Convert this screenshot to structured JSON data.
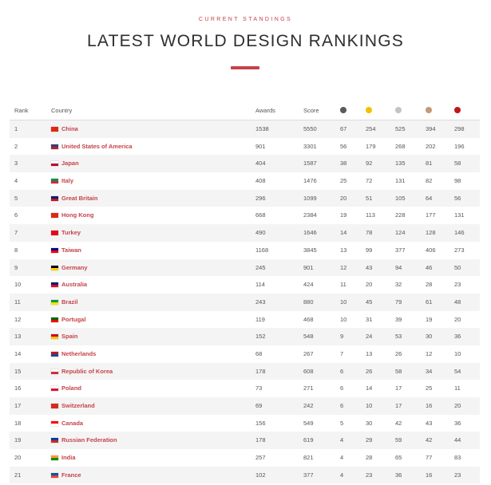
{
  "header": {
    "eyebrow": "CURRENT STANDINGS",
    "title": "LATEST WORLD DESIGN RANKINGS"
  },
  "table": {
    "columns": {
      "rank": "Rank",
      "country": "Country",
      "awards": "Awards",
      "score": "Score"
    },
    "medal_colors": [
      "#5a5a5a",
      "#f2c200",
      "#c4c4c4",
      "#c49a78",
      "#c0171c"
    ],
    "rows": [
      {
        "rank": "1",
        "country": "China",
        "flag": [
          "#de2910",
          "#de2910"
        ],
        "awards": "1538",
        "score": "5550",
        "m": [
          "67",
          "254",
          "525",
          "394",
          "298"
        ]
      },
      {
        "rank": "2",
        "country": "United States of America",
        "flag": [
          "#3c3b6e",
          "#b22234"
        ],
        "awards": "901",
        "score": "3301",
        "m": [
          "56",
          "179",
          "268",
          "202",
          "196"
        ]
      },
      {
        "rank": "3",
        "country": "Japan",
        "flag": [
          "#ffffff",
          "#bc002d"
        ],
        "awards": "404",
        "score": "1587",
        "m": [
          "38",
          "92",
          "135",
          "81",
          "58"
        ]
      },
      {
        "rank": "4",
        "country": "Italy",
        "flag": [
          "#009246",
          "#ce2b37"
        ],
        "awards": "408",
        "score": "1476",
        "m": [
          "25",
          "72",
          "131",
          "82",
          "98"
        ]
      },
      {
        "rank": "5",
        "country": "Great Britain",
        "flag": [
          "#012169",
          "#c8102e"
        ],
        "awards": "296",
        "score": "1099",
        "m": [
          "20",
          "51",
          "105",
          "64",
          "56"
        ]
      },
      {
        "rank": "6",
        "country": "Hong Kong",
        "flag": [
          "#de2910",
          "#de2910"
        ],
        "awards": "668",
        "score": "2384",
        "m": [
          "19",
          "113",
          "228",
          "177",
          "131"
        ]
      },
      {
        "rank": "7",
        "country": "Turkey",
        "flag": [
          "#e30a17",
          "#e30a17"
        ],
        "awards": "490",
        "score": "1646",
        "m": [
          "14",
          "78",
          "124",
          "128",
          "146"
        ]
      },
      {
        "rank": "8",
        "country": "Taiwan",
        "flag": [
          "#000095",
          "#fe0000"
        ],
        "awards": "1168",
        "score": "3845",
        "m": [
          "13",
          "99",
          "377",
          "406",
          "273"
        ]
      },
      {
        "rank": "9",
        "country": "Germany",
        "flag": [
          "#000000",
          "#ffce00"
        ],
        "awards": "245",
        "score": "901",
        "m": [
          "12",
          "43",
          "94",
          "46",
          "50"
        ]
      },
      {
        "rank": "10",
        "country": "Australia",
        "flag": [
          "#012169",
          "#e4002b"
        ],
        "awards": "114",
        "score": "424",
        "m": [
          "11",
          "20",
          "32",
          "28",
          "23"
        ]
      },
      {
        "rank": "11",
        "country": "Brazil",
        "flag": [
          "#009c3b",
          "#ffdf00"
        ],
        "awards": "243",
        "score": "880",
        "m": [
          "10",
          "45",
          "79",
          "61",
          "48"
        ]
      },
      {
        "rank": "12",
        "country": "Portugal",
        "flag": [
          "#006600",
          "#ff0000"
        ],
        "awards": "119",
        "score": "468",
        "m": [
          "10",
          "31",
          "39",
          "19",
          "20"
        ]
      },
      {
        "rank": "13",
        "country": "Spain",
        "flag": [
          "#c60b1e",
          "#ffc400"
        ],
        "awards": "152",
        "score": "548",
        "m": [
          "9",
          "24",
          "53",
          "30",
          "36"
        ]
      },
      {
        "rank": "14",
        "country": "Netherlands",
        "flag": [
          "#ae1c28",
          "#21468b"
        ],
        "awards": "68",
        "score": "267",
        "m": [
          "7",
          "13",
          "26",
          "12",
          "10"
        ]
      },
      {
        "rank": "15",
        "country": "Republic of Korea",
        "flag": [
          "#ffffff",
          "#cd2e3a"
        ],
        "awards": "178",
        "score": "608",
        "m": [
          "6",
          "26",
          "58",
          "34",
          "54"
        ]
      },
      {
        "rank": "16",
        "country": "Poland",
        "flag": [
          "#ffffff",
          "#dc143c"
        ],
        "awards": "73",
        "score": "271",
        "m": [
          "6",
          "14",
          "17",
          "25",
          "11"
        ]
      },
      {
        "rank": "17",
        "country": "Switzerland",
        "flag": [
          "#d52b1e",
          "#d52b1e"
        ],
        "awards": "69",
        "score": "242",
        "m": [
          "6",
          "10",
          "17",
          "16",
          "20"
        ]
      },
      {
        "rank": "18",
        "country": "Canada",
        "flag": [
          "#ff0000",
          "#ffffff"
        ],
        "awards": "156",
        "score": "549",
        "m": [
          "5",
          "30",
          "42",
          "43",
          "36"
        ]
      },
      {
        "rank": "19",
        "country": "Russian Federation",
        "flag": [
          "#0039a6",
          "#d52b1e"
        ],
        "awards": "178",
        "score": "619",
        "m": [
          "4",
          "29",
          "59",
          "42",
          "44"
        ]
      },
      {
        "rank": "20",
        "country": "India",
        "flag": [
          "#ff9933",
          "#138808"
        ],
        "awards": "257",
        "score": "821",
        "m": [
          "4",
          "28",
          "65",
          "77",
          "83"
        ]
      },
      {
        "rank": "21",
        "country": "France",
        "flag": [
          "#0055a4",
          "#ef4135"
        ],
        "awards": "102",
        "score": "377",
        "m": [
          "4",
          "23",
          "36",
          "16",
          "23"
        ]
      }
    ]
  }
}
